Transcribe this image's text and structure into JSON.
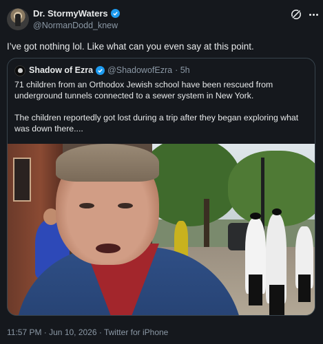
{
  "author": {
    "display_name": "Dr. StormyWaters",
    "handle": "@NormanDodd_knew",
    "avatar_icon": "person-silhouette-avatar",
    "verified": true
  },
  "tweet_text": "I’ve got nothing lol. Like what can you even say at this point.",
  "header_icons": {
    "grok": "grok-slash-icon",
    "more": "more-dots-icon"
  },
  "quoted": {
    "display_name": "Shadow of Ezra",
    "handle": "@ShadowofEzra",
    "time": "· 5h",
    "verified": true,
    "paragraphs": [
      "71 children from an Orthodox Jewish school have been rescued from underground tunnels connected to a sewer system in New York.",
      "The children reportedly got lost during a trip after they began exploring what was down there...."
    ],
    "media": "video-thumbnail"
  },
  "footer": {
    "timestamp": "11:57 PM · Jun 10, 2026 · Twitter for iPhone"
  },
  "colors": {
    "background": "#15181d",
    "text": "#e7e9ea",
    "secondary": "#8b98a5",
    "verified": "#1d9bf0",
    "border": "#38444d"
  }
}
